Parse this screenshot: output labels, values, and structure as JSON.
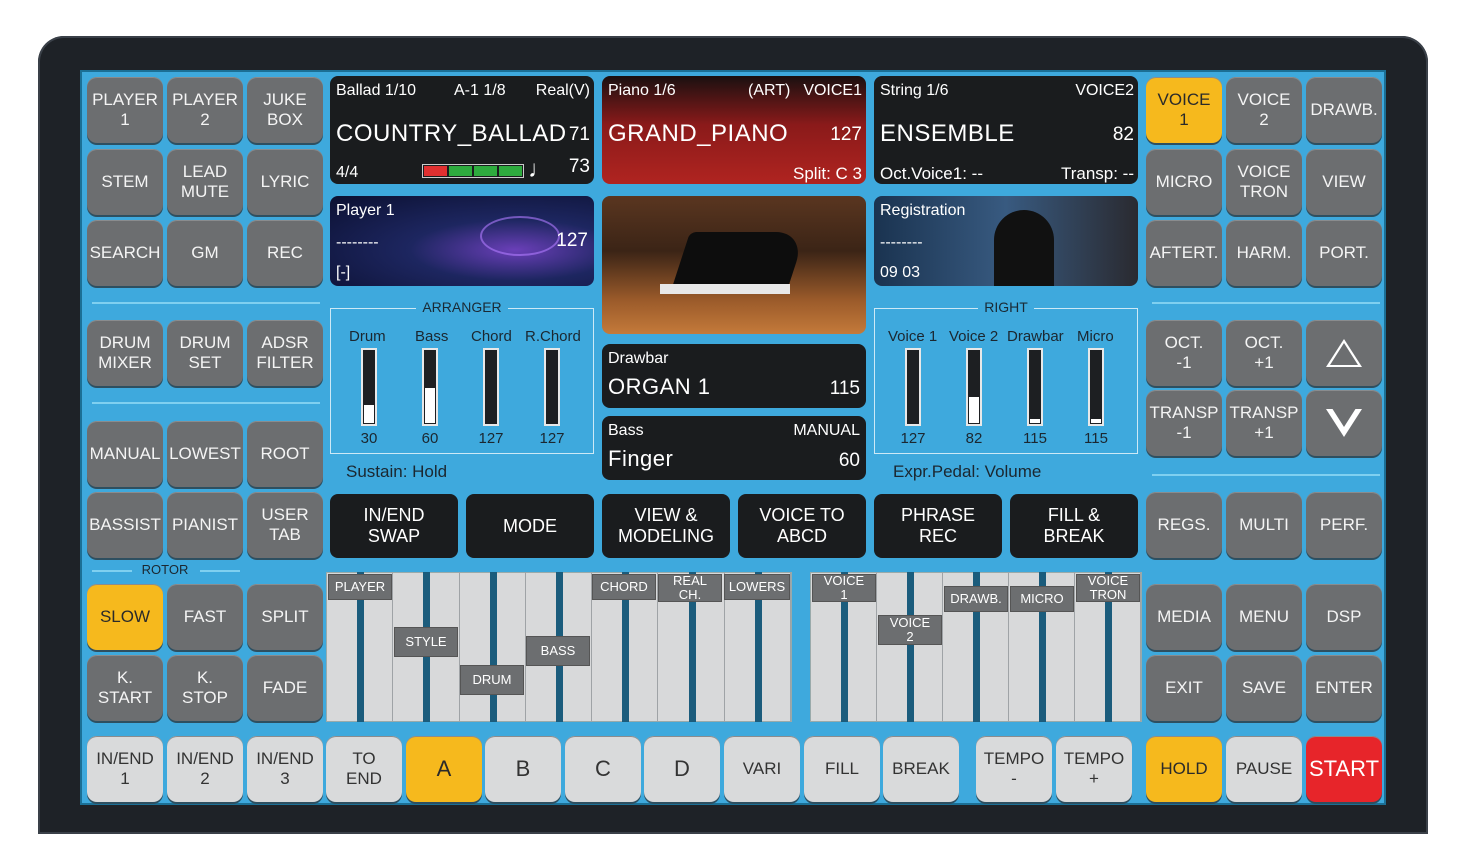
{
  "left_buttons": [
    {
      "label": "PLAYER\n1"
    },
    {
      "label": "PLAYER\n2"
    },
    {
      "label": "JUKE\nBOX"
    },
    {
      "label": "STEM"
    },
    {
      "label": "LEAD\nMUTE"
    },
    {
      "label": "LYRIC"
    },
    {
      "label": "SEARCH"
    },
    {
      "label": "GM"
    },
    {
      "label": "REC"
    },
    {
      "label": "DRUM\nMIXER"
    },
    {
      "label": "DRUM\nSET"
    },
    {
      "label": "ADSR\nFILTER"
    },
    {
      "label": "MANUAL"
    },
    {
      "label": "LOWEST"
    },
    {
      "label": "ROOT"
    },
    {
      "label": "BASSIST"
    },
    {
      "label": "PIANIST"
    },
    {
      "label": "USER\nTAB"
    },
    {
      "label": "SLOW"
    },
    {
      "label": "FAST"
    },
    {
      "label": "SPLIT"
    },
    {
      "label": "K.\nSTART"
    },
    {
      "label": "K.\nSTOP"
    },
    {
      "label": "FADE"
    }
  ],
  "rotor_label": "ROTOR",
  "right_buttons": [
    {
      "label": "VOICE\n1"
    },
    {
      "label": "VOICE\n2"
    },
    {
      "label": "DRAWB."
    },
    {
      "label": "MICRO"
    },
    {
      "label": "VOICE\nTRON"
    },
    {
      "label": "VIEW"
    },
    {
      "label": "AFTERT."
    },
    {
      "label": "HARM."
    },
    {
      "label": "PORT."
    },
    {
      "label": "OCT.\n-1"
    },
    {
      "label": "OCT.\n+1"
    },
    {
      "label": "TRANSP\n-1"
    },
    {
      "label": "TRANSP\n+1"
    },
    {
      "label": "REGS."
    },
    {
      "label": "MULTI"
    },
    {
      "label": "PERF."
    },
    {
      "label": "MEDIA"
    },
    {
      "label": "MENU"
    },
    {
      "label": "DSP"
    },
    {
      "label": "EXIT"
    },
    {
      "label": "SAVE"
    },
    {
      "label": "ENTER"
    }
  ],
  "bottom_buttons": [
    {
      "label": "IN/END\n1"
    },
    {
      "label": "IN/END\n2"
    },
    {
      "label": "IN/END\n3"
    },
    {
      "label": "TO\nEND"
    },
    {
      "label": "A"
    },
    {
      "label": "B"
    },
    {
      "label": "C"
    },
    {
      "label": "D"
    },
    {
      "label": "VARI"
    },
    {
      "label": "FILL"
    },
    {
      "label": "BREAK"
    },
    {
      "label": "TEMPO\n-"
    },
    {
      "label": "TEMPO\n+"
    },
    {
      "label": "HOLD"
    },
    {
      "label": "PAUSE"
    },
    {
      "label": "START"
    }
  ],
  "style_panel": {
    "header_left": "Ballad 1/10",
    "header_mid": "A-1 1/8",
    "header_right": "Real(V)",
    "name": "COUNTRY_BALLAD",
    "value1": "71",
    "time_sig": "4/4",
    "tempo": "73",
    "note": "♩"
  },
  "voice1_panel": {
    "header_left": "Piano 1/6",
    "header_mid": "(ART)",
    "header_right": "VOICE1",
    "name": "GRAND_PIANO",
    "value": "127",
    "footer": "Split: C 3"
  },
  "voice2_panel": {
    "header_left": "String 1/6",
    "header_right": "VOICE2",
    "name": "ENSEMBLE",
    "value": "82",
    "footer_left": "Oct.Voice1: --",
    "footer_right": "Transp: --"
  },
  "player_panel": {
    "title": "Player 1",
    "dashes": "--------",
    "value": "127",
    "bracket": "[-]"
  },
  "registration_panel": {
    "title": "Registration",
    "dashes": "--------",
    "value": "09 03"
  },
  "drawbar_panel": {
    "title": "Drawbar",
    "name": "ORGAN 1",
    "value": "115"
  },
  "bass_panel": {
    "title": "Bass",
    "mode": "MANUAL",
    "name": "Finger",
    "value": "60"
  },
  "arranger": {
    "title": "ARRANGER",
    "sustain": "Sustain: Hold",
    "faders": [
      {
        "label": "Drum",
        "value": "30",
        "level": 0.24
      },
      {
        "label": "Bass",
        "value": "60",
        "level": 0.47
      },
      {
        "label": "Chord",
        "value": "127",
        "level": 0
      },
      {
        "label": "R.Chord",
        "value": "127",
        "level": 0
      }
    ]
  },
  "right_group": {
    "title": "RIGHT",
    "expr": "Expr.Pedal: Volume",
    "faders": [
      {
        "label": "Voice 1",
        "value": "127",
        "level": 0
      },
      {
        "label": "Voice 2",
        "value": "82",
        "level": 0.35
      },
      {
        "label": "Drawbar",
        "value": "115",
        "level": 0.05
      },
      {
        "label": "Micro",
        "value": "115",
        "level": 0.05
      }
    ]
  },
  "mid_buttons": [
    {
      "label": "IN/END\nSWAP"
    },
    {
      "label": "MODE"
    },
    {
      "label": "VIEW &\nMODELING"
    },
    {
      "label": "VOICE TO\nABCD"
    },
    {
      "label": "PHRASE\nREC"
    },
    {
      "label": "FILL &\nBREAK"
    }
  ],
  "keyboard_labels": {
    "player": "PLAYER",
    "style": "STYLE",
    "drum": "DRUM",
    "bass": "BASS",
    "chord": "CHORD",
    "real_ch": "REAL\nCH.",
    "lowers": "LOWERS",
    "voice1": "VOICE\n1",
    "voice2": "VOICE\n2",
    "drawb": "DRAWB.",
    "micro": "MICRO",
    "voicetron": "VOICE\nTRON"
  },
  "colors": {
    "screen": "#3ea9dd",
    "button": "#6c6e70",
    "active": "#f6b91d",
    "start": "#e7252a"
  }
}
